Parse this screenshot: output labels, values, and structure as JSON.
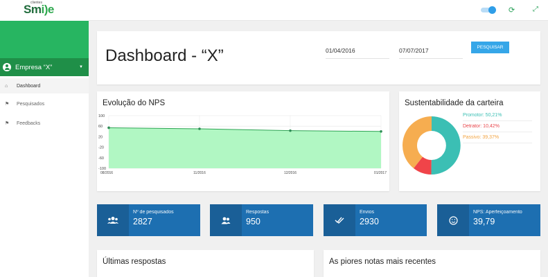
{
  "brand": {
    "small": "clientes",
    "name_a": "Sm",
    "name_b": "i)e"
  },
  "sidebar": {
    "company": "Empresa “X”",
    "items": [
      {
        "label": "Dashboard",
        "icon": "home-icon"
      },
      {
        "label": "Pesquisados",
        "icon": "flag-icon"
      },
      {
        "label": "Feedbacks",
        "icon": "flag-icon"
      }
    ]
  },
  "topbar": {
    "icons": [
      "toggle-switch",
      "refresh-icon",
      "fullscreen-icon"
    ]
  },
  "header": {
    "title": "Dashboard - “X”",
    "date_start": "01/04/2016",
    "date_end": "07/07/2017",
    "search_label": "PESQUISAR"
  },
  "nps": {
    "title": "Evolução do NPS",
    "chart_data": {
      "type": "area",
      "x": [
        "08/2016",
        "11/2016",
        "12/2016",
        "01/2017"
      ],
      "values": [
        54,
        50,
        43,
        40
      ],
      "yticks": [
        100,
        60,
        20,
        -20,
        -60,
        -100
      ],
      "ylim": [
        -100,
        100
      ],
      "grid": true,
      "colors": {
        "fill": "#b1f7c3",
        "line": "#2ea454",
        "point": "#2e8d56"
      }
    }
  },
  "sustent": {
    "title": "Sustentabilidade da carteira",
    "chart_data": {
      "type": "pie",
      "slices": [
        {
          "label": "Promotor",
          "value": 50.21,
          "text": "Promotor: 50,21%",
          "color": "#3bbfb4"
        },
        {
          "label": "Detrator",
          "value": 10.42,
          "text": "Detrator: 10,42%",
          "color": "#f04449"
        },
        {
          "label": "Passivo",
          "value": 39.37,
          "text": "Passivo: 39,37%",
          "color": "#f6ad50"
        }
      ]
    }
  },
  "stats": [
    {
      "label": "Nº de pesquisados",
      "value": "2827",
      "icon": "people-group-icon"
    },
    {
      "label": "Respostas",
      "value": "950",
      "icon": "people-icon"
    },
    {
      "label": "Envios",
      "value": "2930",
      "icon": "double-check-icon"
    },
    {
      "label": "NPS: Aperfeiçoamento",
      "value": "39,79",
      "icon": "smile-icon"
    }
  ],
  "bottom": {
    "left_title": "Últimas respostas",
    "right_title": "As piores notas mais recentes"
  }
}
